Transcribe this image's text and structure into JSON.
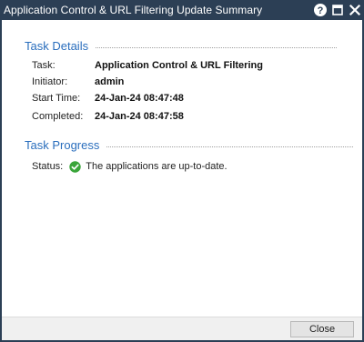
{
  "window": {
    "title": "Application Control & URL Filtering Update Summary",
    "icons": [
      "help-icon",
      "maximize-icon",
      "close-icon"
    ],
    "titlebar_color": "#2c3f55"
  },
  "task_details": {
    "header": "Task Details",
    "rows": [
      {
        "label": "Task:",
        "value": "Application Control & URL Filtering"
      },
      {
        "label": "Initiator:",
        "value": "admin"
      },
      {
        "label": "Start Time:",
        "value": "24-Jan-24 08:47:48"
      },
      {
        "label": "Completed:",
        "value": "24-Jan-24 08:47:58"
      }
    ]
  },
  "task_progress": {
    "header": "Task Progress",
    "status_label": "Status:",
    "status_icon": "check-circle-icon",
    "status_text": "The applications are up-to-date.",
    "status_color": "#3aa53a"
  },
  "footer": {
    "close_label": "Close"
  },
  "colors": {
    "section_header": "#2a6ebd"
  }
}
